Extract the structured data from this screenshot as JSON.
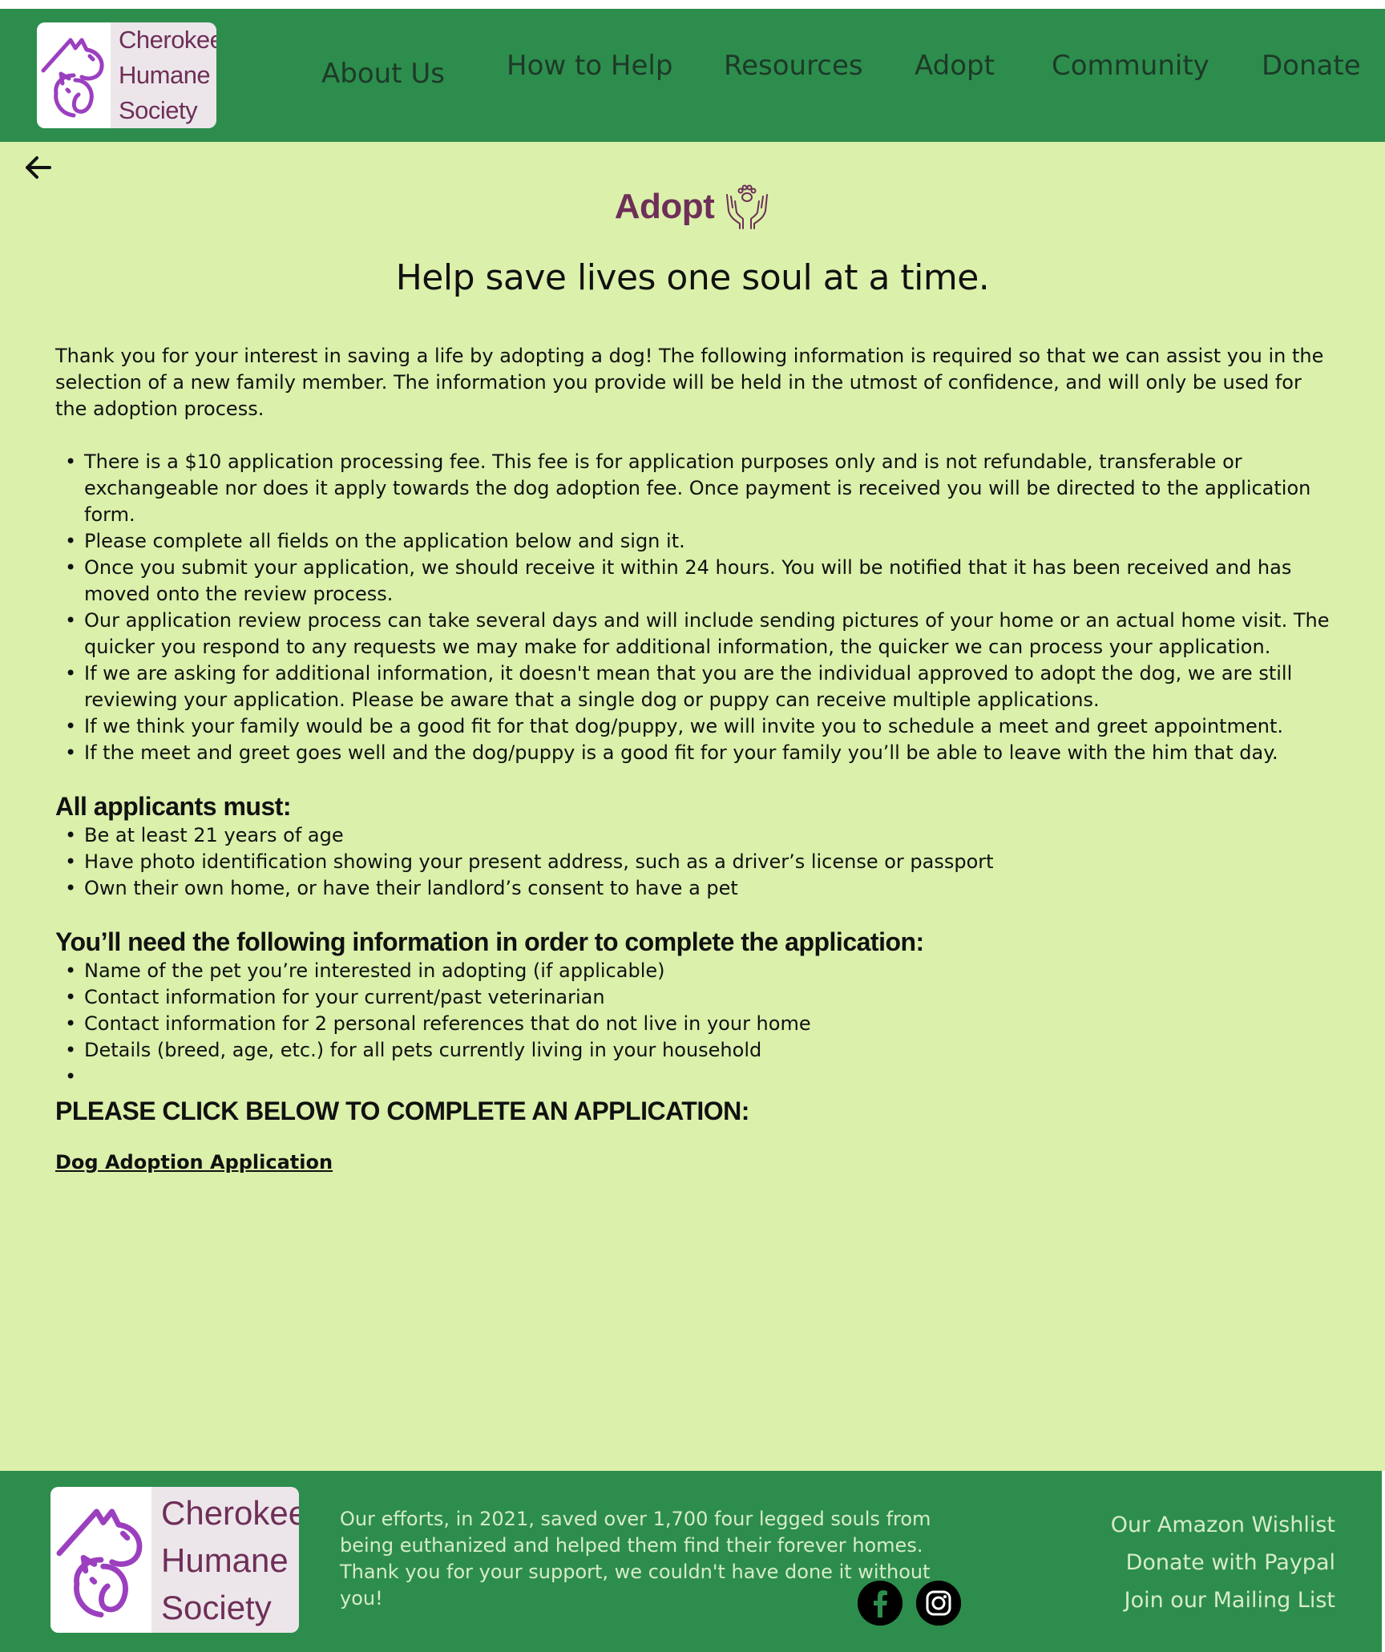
{
  "brand": {
    "name_lines": [
      "Cherokee",
      "Humane",
      "Society"
    ],
    "colors": {
      "header_bg": "#2d8d4d",
      "page_bg": "#dbf0ab",
      "accent": "#6e2f58",
      "logo_mark": "#9b3fbf"
    }
  },
  "nav": {
    "items": [
      "About Us",
      "How to Help",
      "Resources",
      "Adopt",
      "Community",
      "Donate"
    ]
  },
  "page": {
    "back_icon": "arrow-left-icon",
    "title": "Adopt",
    "title_icon": "hands-paw-icon",
    "tagline": "Help save lives one soul at a time.",
    "intro": "Thank you for your interest in saving a life by adopting a dog! The following information is required so that we can assist you in the selection of a new family member. The information you provide will be held in the utmost of confidence, and will only be used for the adoption process.",
    "process_items": [
      "There is a $10 application processing fee. This fee is for application purposes only and is not refundable, transferable or exchangeable nor does it apply towards the dog adoption fee. Once payment is received you will be directed to the application form.",
      "Please complete all fields on the application below and sign it.",
      "Once you submit your application, we should receive it within 24 hours. You will be notified that it has been received and has moved onto the review process.",
      "Our application review process can take several days and will include sending pictures of your home or an actual home visit. The quicker you respond to any requests we may make for additional information, the quicker we can process your application.",
      "If we are asking for additional information, it doesn't mean that you are the individual approved to adopt the dog, we are still reviewing your application. Please be aware that a single dog or puppy can receive multiple applications.",
      "If we think your family would be a good fit for that dog/puppy, we will invite you to schedule a meet and greet appointment.",
      "If the meet and greet goes well and the dog/puppy is a good fit for your family you’ll be able to leave with the him that day."
    ],
    "applicants_heading": "All applicants must:",
    "applicant_items": [
      "Be at least 21 years of age",
      "Have photo identification showing your present address, such as a driver’s license or passport",
      "Own their own home, or have their landlord’s consent to have a pet"
    ],
    "info_heading": "You’ll need the following information in order to complete the application:",
    "info_items": [
      "Name of the pet you’re interested in adopting (if applicable)",
      "Contact information for your current/past veterinarian",
      "Contact information for 2 personal references that do not live in your home",
      "Details (breed, age, etc.) for all pets currently living in your household",
      ""
    ],
    "cta_heading": "PLEASE CLICK BELOW TO COMPLETE AN APPLICATION:",
    "cta_link": "Dog Adoption Application"
  },
  "footer": {
    "text": "Our efforts, in 2021, saved over 1,700 four legged souls from being euthanized and helped them find their forever homes. Thank you for your support, we couldn't have done it without you!",
    "social_icons": [
      "facebook-icon",
      "instagram-icon"
    ],
    "links": [
      "Our Amazon Wishlist",
      "Donate with Paypal",
      "Join our Mailing List"
    ]
  }
}
